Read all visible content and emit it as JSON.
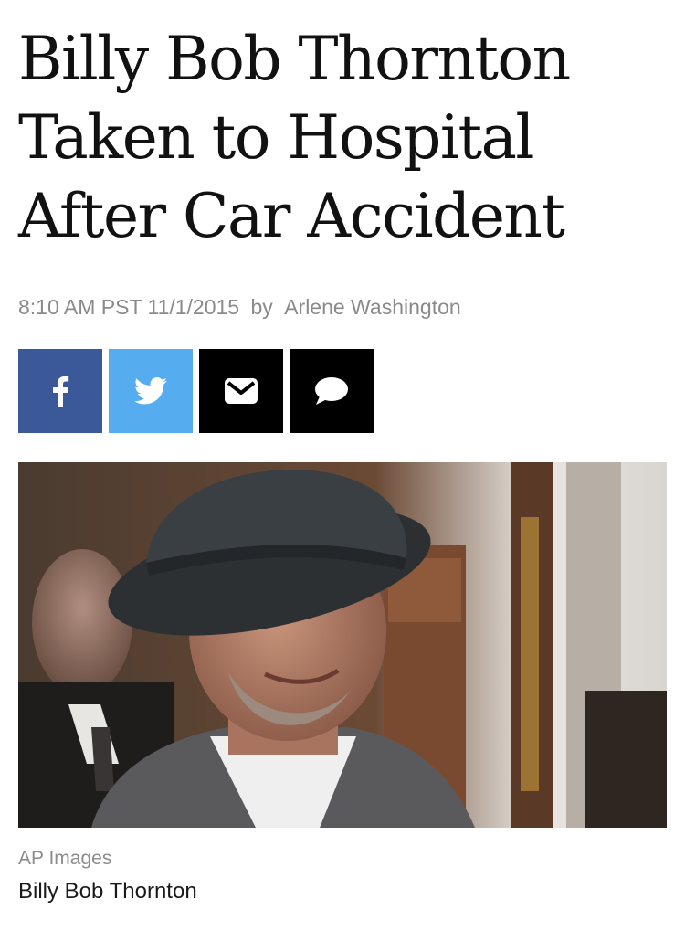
{
  "article": {
    "headline_lines": [
      "Billy Bob Thornton",
      "Taken to Hospital",
      "After Car Accident"
    ],
    "timestamp": "8:10 AM PST 11/1/2015",
    "byline_prefix": "by",
    "author": "Arlene Washington",
    "photo_credit": "AP Images",
    "photo_caption": "Billy Bob Thornton"
  },
  "share": [
    {
      "icon": "facebook-icon",
      "color": "#3b5998"
    },
    {
      "icon": "twitter-icon",
      "color": "#55acee"
    },
    {
      "icon": "email-icon",
      "color": "#000000"
    },
    {
      "icon": "comment-icon",
      "color": "#000000"
    }
  ]
}
